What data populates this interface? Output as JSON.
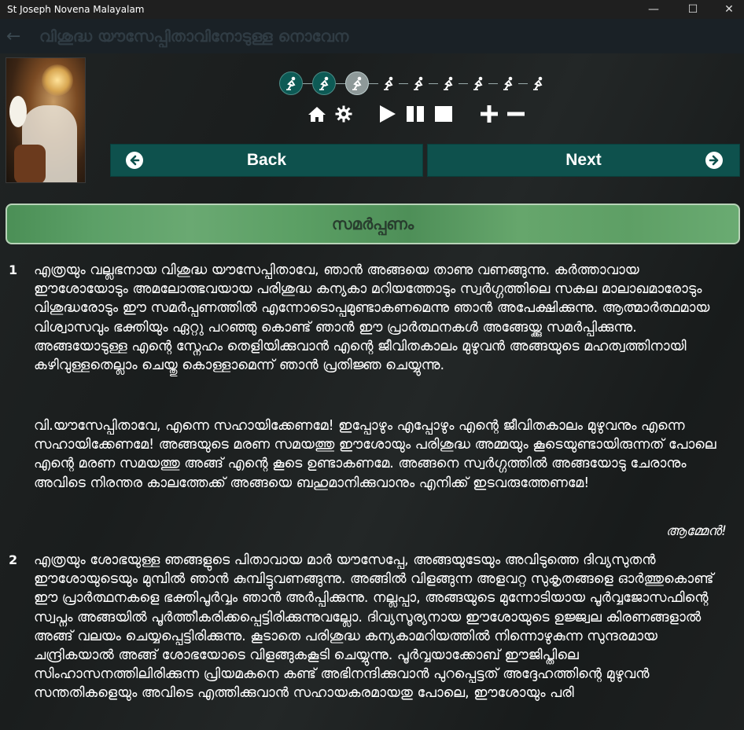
{
  "window": {
    "title": "St Joseph Novena Malayalam",
    "minimize": "—",
    "maximize": "☐",
    "close": "✕"
  },
  "header": {
    "back_icon": "←",
    "title": "വിശുദ്ധ യൗസേപ്പിതാവിനോടുള്ള നൊവേന"
  },
  "progress": {
    "icon": "praying-person-icon",
    "states": [
      "done",
      "done",
      "current",
      "todo",
      "todo",
      "todo",
      "todo",
      "todo",
      "todo"
    ]
  },
  "toolbar": {
    "home": "home-icon",
    "settings": "gear-icon",
    "play": "play-icon",
    "pause": "pause-icon",
    "stop": "stop-icon",
    "zoom_in": "plus-icon",
    "zoom_out": "minus-icon"
  },
  "nav": {
    "back_label": "Back",
    "next_label": "Next"
  },
  "section": {
    "title": "സമർപ്പണം"
  },
  "paragraphs": [
    {
      "number": "1",
      "text1": "എത്രയും വല്ലഭനായ വിശുദ്ധ യൗസേപ്പിതാവേ, ഞാൻ അങ്ങയെ താണു വണങ്ങുന്നു. കർത്താവായ ഈശോയോടും അമലോത്ഭവയായ പരിശുദ്ധ കന്യകാ മറിയത്തോടും സ്വർഗ്ഗത്തിലെ സകല മാലാഖമാരോടും വിശുദ്ധരോടും ഈ സമർപ്പണത്തിൽ എന്നോടൊപ്പമുണ്ടാകണമെന്നു ഞാൻ അപേക്ഷിക്കുന്നു. ആത്മാർത്ഥമായ വിശ്വാസവും ഭക്തിയും ഏറ്റു പറഞ്ഞു കൊണ്ട് ഞാൻ ഈ പ്രാർത്ഥനകൾ അങ്ങേയ്ക്കു സമർപ്പിക്കുന്നു. അങ്ങയോടുള്ള എന്റെ സ്നേഹം തെളിയിക്കുവാൻ എന്റെ ജീവിതകാലം മുഴുവൻ അങ്ങയുടെ മഹത്വത്തിനായി കഴിവുള്ളതെല്ലാം ചെയ്തു കൊള്ളാമെന്ന് ഞാൻ പ്രതിജ്ഞ ചെയ്യുന്നു.",
      "text2": "വി.യൗസേപ്പിതാവേ, എന്നെ സഹായിക്കേണമേ! ഇപ്പോഴും എപ്പോഴും എന്റെ ജീവിതകാലം മുഴുവനും എന്നെ സഹായിക്കേണമേ! അങ്ങയുടെ മരണ സമയത്തു ഈശോയും പരിശുദ്ധ അമ്മയും കൂടെയുണ്ടായിരുന്നത് പോലെ എന്റെ മരണ സമയത്തു അങ്ങ് എന്റെ കൂടെ ഉണ്ടാകണമേ. അങ്ങനെ സ്വർഗ്ഗത്തിൽ അങ്ങയോടു ചേരാനും അവിടെ നിരന്തര കാലത്തേക്ക് അങ്ങയെ ബഹുമാനിക്കുവാനും എനിക്ക് ഇടവരുത്തേണമേ!",
      "amen": "ആമ്മേൻ!"
    },
    {
      "number": "2",
      "text1": "എത്രയും ശോഭയുള്ള ഞങ്ങളുടെ പിതാവായ മാർ യൗസേപ്പേ, അങ്ങയുടേയും അവിടുത്തെ ദിവ്യസുതൻ ഈശോയുടെയും മുമ്പിൽ ഞാൻ കുമ്പിട്ടുവണങ്ങുന്നു. അങ്ങിൽ വിളങ്ങുന്ന അളവറ്റ സുകൃതങ്ങളെ ഓർത്തുകൊണ്ട് ഈ പ്രാർത്ഥനകളെ ഭക്തിപൂർവ്വം ഞാൻ അർപ്പിക്കുന്നു. നല്ലപ്പാ, അങ്ങയുടെ മുന്നോടിയായ പൂർവ്വജോസഫിന്റെ സ്വപ്നം അങ്ങയിൽ പൂർത്തീകരിക്കപ്പെട്ടിരിക്കുന്നുവല്ലോ. ദിവ്യസൂര്യനായ ഈശോയുടെ ഉജ്ജ്വല കിരണങ്ങളാൽ അങ്ങ് വലയം ചെയ്യപ്പെട്ടിരിക്കുന്നു. കൂടാതെ പരിശുദ്ധ കന്യകാമറിയത്തിൽ നിന്നൊഴുകുന്ന സുന്ദരമായ ചന്ദ്രികയാൽ അങ്ങ് ശോഭയോടെ വിളങ്ങുകകൂടി ചെയ്യുന്നു. പൂർവ്വയാക്കോബ് ഈജിപ്തിലെ സിംഹാസനത്തിലിരിക്കുന്ന പ്രിയമകനെ കണ്ട് അഭിനന്ദിക്കുവാൻ പുറപ്പെട്ടത് അദ്ദേഹത്തിന്റെ മുഴുവൻ സന്തതികളെയും അവിടെ എത്തിക്കുവാൻ സഹായകരമായതു പോലെ, ഈശോയും പരി"
    }
  ]
}
